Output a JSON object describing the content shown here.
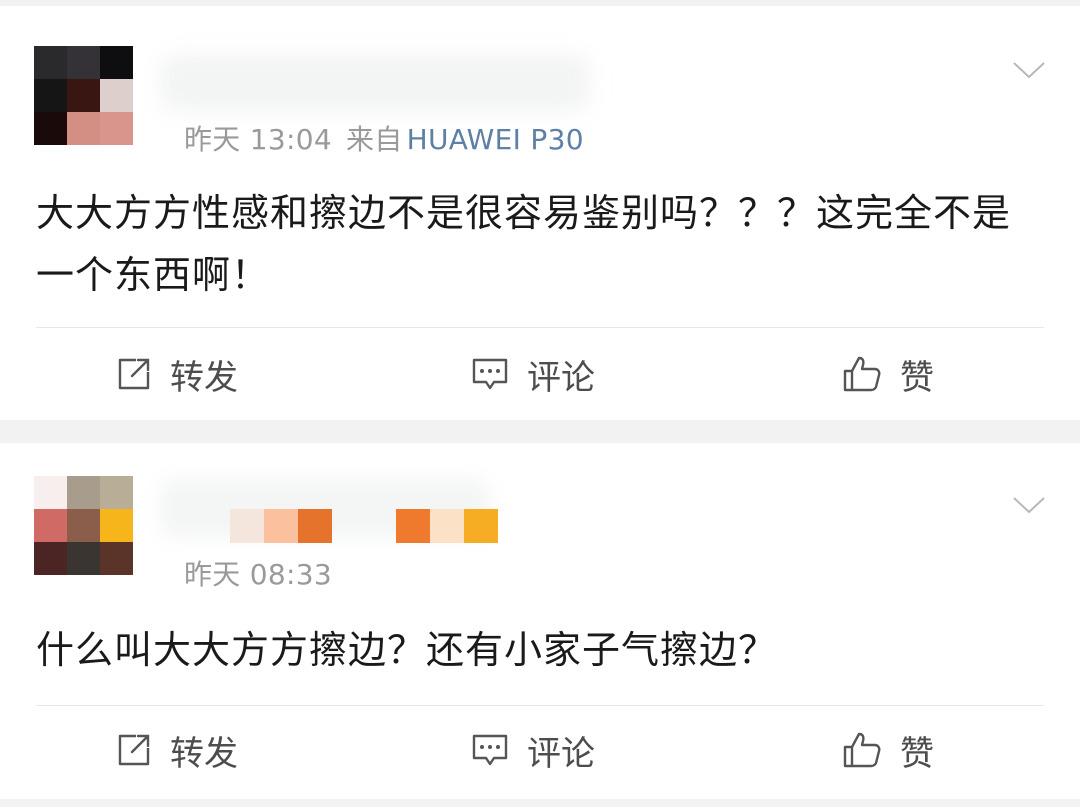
{
  "posts": [
    {
      "time": "昨天 13:04",
      "from_label": "来自",
      "source": "HUAWEI P30",
      "content": "大大方方性感和擦边不是很容易鉴别吗？？？这完全不是一个东西啊！",
      "actions": {
        "repost": "转发",
        "comment": "评论",
        "like": "赞"
      }
    },
    {
      "time": "昨天 08:33",
      "content": "什么叫大大方方擦边？还有小家子气擦边？",
      "actions": {
        "repost": "转发",
        "comment": "评论",
        "like": "赞"
      }
    }
  ],
  "icons": {
    "repost": "share-icon",
    "comment": "comment-icon",
    "like": "thumbs-up-icon",
    "expand": "chevron-down-icon"
  },
  "colors": {
    "source_link": "#5e7fa6",
    "meta_text": "#9a9a9a",
    "content_text": "#1a1a1a",
    "background": "#f2f2f2"
  }
}
